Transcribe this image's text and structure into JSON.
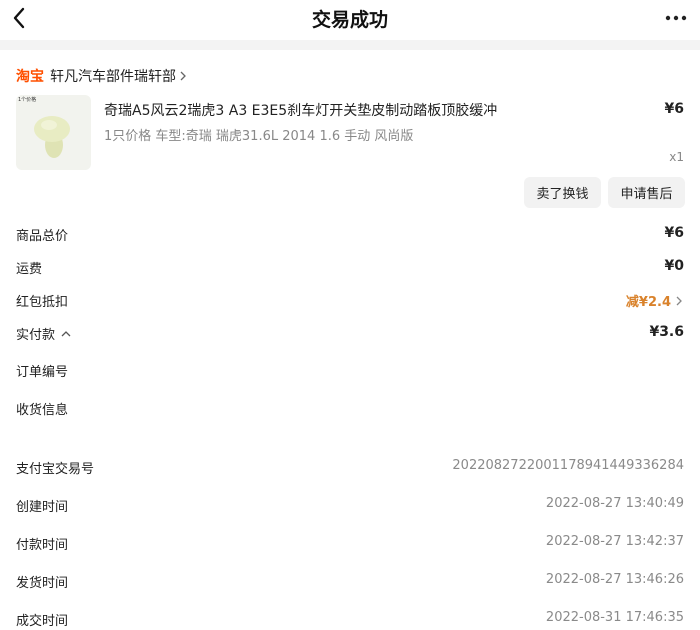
{
  "header": {
    "title": "交易成功"
  },
  "shop": {
    "platform": "淘宝",
    "name": "轩凡汽车部件瑞轩部"
  },
  "product": {
    "thumb_caption": "1个价格",
    "title": "奇瑞A5风云2瑞虎3 A3 E3E5刹车灯开关垫皮制动踏板顶胶缓冲",
    "price": "¥6",
    "sku": "1只价格  车型:奇瑞 瑞虎31.6L 2014 1.6 手动 风尚版",
    "quantity": "x1"
  },
  "actions": {
    "sell": "卖了换钱",
    "after_sale": "申请售后"
  },
  "summary": {
    "goods_total_label": "商品总价",
    "goods_total": "¥6",
    "shipping_label": "运费",
    "shipping": "¥0",
    "coupon_label": "红包抵扣",
    "coupon": "减¥2.4",
    "paid_label": "实付款",
    "paid": "¥3.6",
    "order_no_label": "订单编号",
    "delivery_label": "收货信息"
  },
  "details": {
    "alipay_label": "支付宝交易号",
    "alipay": "2022082722001178941449336284",
    "created_label": "创建时间",
    "created": "2022-08-27 13:40:49",
    "paid_label": "付款时间",
    "paid": "2022-08-27 13:42:37",
    "shipped_label": "发货时间",
    "shipped": "2022-08-27 13:46:26",
    "completed_label": "成交时间",
    "completed": "2022-08-31 17:46:35"
  },
  "colors": {
    "brand": "#ff5000",
    "discount": "#d9822b",
    "muted": "#8a8a8a",
    "band": "#f3f3f3"
  }
}
